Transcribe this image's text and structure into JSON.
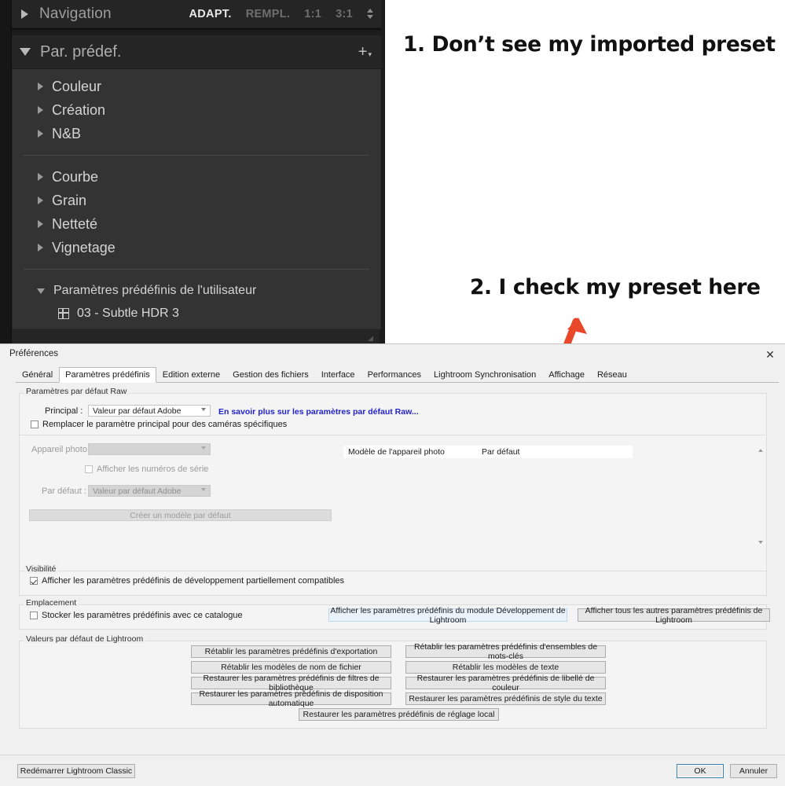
{
  "lightroom_panel": {
    "navigator": {
      "title": "Navigation",
      "disclosure": "collapsed",
      "zoom_levels": [
        {
          "label": "ADAPT.",
          "active": true
        },
        {
          "label": "REMPL.",
          "active": false
        },
        {
          "label": "1:1",
          "active": false
        },
        {
          "label": "3:1",
          "active": false
        }
      ]
    },
    "presets": {
      "title": "Par. prédef.",
      "add_button": "+",
      "groups_top": [
        "Couleur",
        "Création",
        "N&B"
      ],
      "groups_bottom": [
        "Courbe",
        "Grain",
        "Netteté",
        "Vignetage"
      ],
      "user_group": "Paramètres prédéfinis de l'utilisateur",
      "user_presets": [
        "03 - Subtle HDR 3"
      ]
    }
  },
  "annotations": [
    {
      "id": "a1",
      "text": "1. Don’t see my imported preset"
    },
    {
      "id": "a2",
      "text": "2. I check my preset here"
    }
  ],
  "callout": {
    "arrow_color": "#e8472a",
    "circle_color": "#e8472a"
  },
  "preferences": {
    "title": "Préférences",
    "close_label": "✕",
    "tabs": [
      {
        "label": "Général",
        "active": false
      },
      {
        "label": "Paramètres prédéfinis",
        "active": true
      },
      {
        "label": "Edition externe",
        "active": false
      },
      {
        "label": "Gestion des fichiers",
        "active": false
      },
      {
        "label": "Interface",
        "active": false
      },
      {
        "label": "Performances",
        "active": false
      },
      {
        "label": "Lightroom Synchronisation",
        "active": false
      },
      {
        "label": "Affichage",
        "active": false
      },
      {
        "label": "Réseau",
        "active": false
      }
    ],
    "raw_defaults": {
      "legend": "Paramètres par défaut Raw",
      "master_label": "Principal :",
      "master_value": "Valeur par défaut Adobe",
      "learn_more_link": "En savoir plus sur les paramètres par défaut Raw...",
      "override_checkbox": {
        "label": "Remplacer le paramètre principal pour des caméras spécifiques",
        "checked": false
      },
      "camera_label": "Appareil photo :",
      "camera_value": "",
      "serial_checkbox": {
        "label": "Afficher les numéros de série",
        "checked": false
      },
      "default_label": "Par défaut :",
      "default_value": "Valeur par défaut Adobe",
      "create_default_button": "Créer un modèle par défaut",
      "table": {
        "headers": [
          "Modèle de l'appareil photo",
          "Par défaut"
        ],
        "rows": []
      }
    },
    "visibility": {
      "legend": "Visibilité",
      "checkbox": {
        "label": "Afficher les paramètres prédéfinis de développement partiellement compatibles",
        "checked": true
      }
    },
    "location": {
      "legend": "Emplacement",
      "checkbox": {
        "label": "Stocker les paramètres prédéfinis avec ce catalogue",
        "checked": false
      },
      "show_develop_button": "Afficher les paramètres prédéfinis du module Développement de Lightroom",
      "show_all_button": "Afficher tous les autres paramètres prédéfinis de Lightroom"
    },
    "lightroom_defaults": {
      "legend": "Valeurs par défaut de Lightroom",
      "buttons_left": [
        "Rétablir les paramètres prédéfinis d'exportation",
        "Rétablir les modèles de nom de fichier",
        "Restaurer les paramètres prédéfinis de filtres de bibliothèque",
        "Restaurer les paramètres prédéfinis de disposition automatique"
      ],
      "buttons_right": [
        "Rétablir les paramètres prédéfinis d'ensembles de mots-clés",
        "Rétablir les modèles de texte",
        "Restaurer les paramètres prédéfinis de libellé de couleur",
        "Restaurer les paramètres prédéfinis de style du texte"
      ],
      "button_center": "Restaurer les paramètres prédéfinis de réglage local"
    },
    "footer": {
      "restart_button": "Redémarrer Lightroom Classic",
      "ok_button": "OK",
      "cancel_button": "Annuler"
    }
  }
}
